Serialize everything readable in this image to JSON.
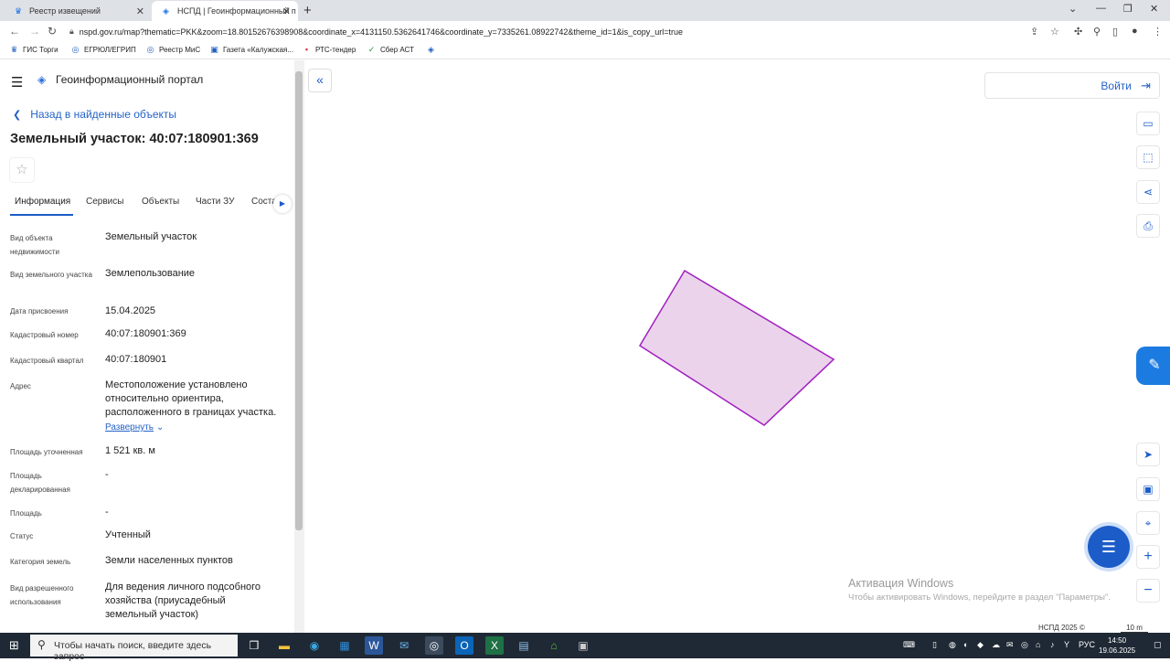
{
  "browser": {
    "tabs": [
      {
        "title": "Реестр извещений",
        "active": false
      },
      {
        "title": "НСПД | Геоинформационный п",
        "active": true
      }
    ],
    "url": "nspd.gov.ru/map?thematic=PKK&zoom=18.80152676398908&coordinate_x=4131150.5362641746&coordinate_y=7335261.08922742&theme_id=1&is_copy_url=true",
    "bookmarks": [
      "ГИС Торги",
      "ЕГРЮЛ/ЕГРИП",
      "Реестр МиС",
      "Газета «Калужская...",
      "РТС-тендер",
      "Сбер АСТ"
    ]
  },
  "panel": {
    "portal_title": "Геоинформационный портал",
    "back_label": "Назад в найденные объекты",
    "object_title": "Земельный участок: 40:07:180901:369",
    "tabs": [
      "Информация",
      "Сервисы",
      "Объекты",
      "Части ЗУ",
      "Соста"
    ],
    "properties": [
      {
        "label": "Вид объекта недвижимости",
        "value": "Земельный участок"
      },
      {
        "label": "Вид земельного участка",
        "value": "Землепользование"
      },
      {
        "label": "Дата присвоения",
        "value": "15.04.2025"
      },
      {
        "label": "Кадастровый номер",
        "value": "40:07:180901:369"
      },
      {
        "label": "Кадастровый квартал",
        "value": "40:07:180901"
      },
      {
        "label": "Адрес",
        "value": "Местоположение установлено относительно ориентира, расположенного в границах участка."
      },
      {
        "label": "Площадь уточненная",
        "value": "1 521 кв. м"
      },
      {
        "label": "Площадь декларированная",
        "value": "-"
      },
      {
        "label": "Площадь",
        "value": "-"
      },
      {
        "label": "Статус",
        "value": "Учтенный"
      },
      {
        "label": "Категория земель",
        "value": "Земли населенных пунктов"
      },
      {
        "label": "Вид разрешенного использования",
        "value": "Для ведения личного подсобного хозяйства (приусадебный земельный участок)"
      }
    ],
    "expand_label": "Развернуть"
  },
  "map": {
    "login_label": "Войти",
    "parcel_fill": "#ecd3ec",
    "parcel_stroke": "#a020c0",
    "activation_title": "Активация Windows",
    "activation_text": "Чтобы активировать Windows, перейдите в раздел \"Параметры\".",
    "copyright": "НСПД 2025 ©",
    "scale_label": "10 m"
  },
  "taskbar": {
    "search_placeholder": "Чтобы начать поиск, введите здесь запрос",
    "lang": "РУС",
    "time": "14:50",
    "date": "19.06.2025"
  }
}
